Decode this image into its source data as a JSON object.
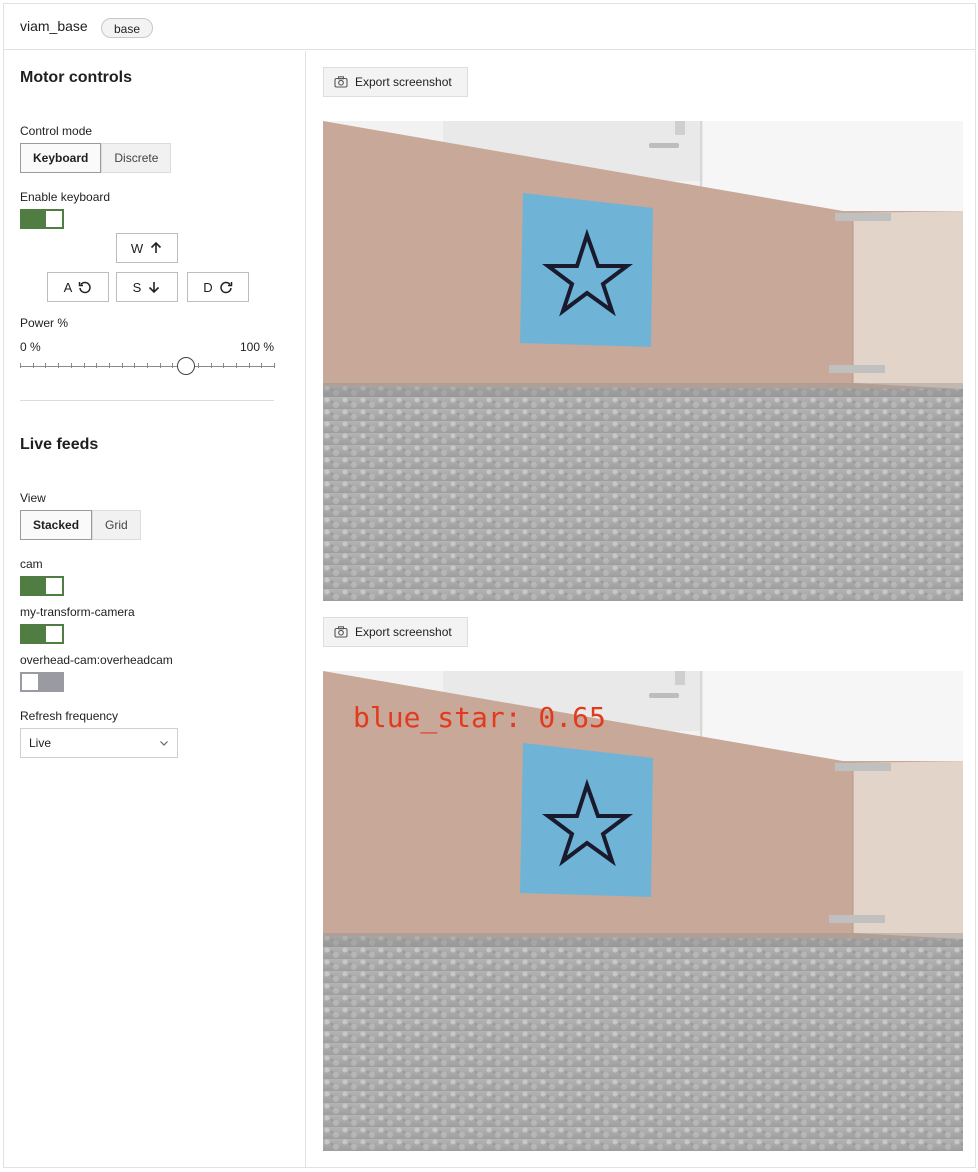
{
  "header": {
    "component_name": "viam_base",
    "component_type": "base"
  },
  "motor_controls": {
    "title": "Motor controls",
    "control_mode_label": "Control mode",
    "modes": [
      "Keyboard",
      "Discrete"
    ],
    "active_mode": "Keyboard",
    "enable_keyboard_label": "Enable keyboard",
    "keyboard_enabled": true,
    "keys": {
      "w": "W",
      "a": "A",
      "s": "S",
      "d": "D"
    },
    "power_label": "Power %",
    "power_min": "0 %",
    "power_max": "100 %",
    "power_value": 65
  },
  "live_feeds": {
    "title": "Live feeds",
    "view_label": "View",
    "views": [
      "Stacked",
      "Grid"
    ],
    "active_view": "Stacked",
    "cameras": [
      {
        "name": "cam",
        "enabled": true
      },
      {
        "name": "my-transform-camera",
        "enabled": true
      },
      {
        "name": "overhead-cam:overheadcam",
        "enabled": false
      }
    ],
    "refresh_label": "Refresh frequency",
    "refresh_value": "Live"
  },
  "feeds": [
    {
      "export_label": "Export screenshot"
    },
    {
      "export_label": "Export screenshot",
      "detection_label": "blue_star: 0.65"
    }
  ],
  "colors": {
    "toggle_on": "#4f7d42",
    "toggle_off": "#9a9aa2",
    "detection": "#e23a1f"
  }
}
